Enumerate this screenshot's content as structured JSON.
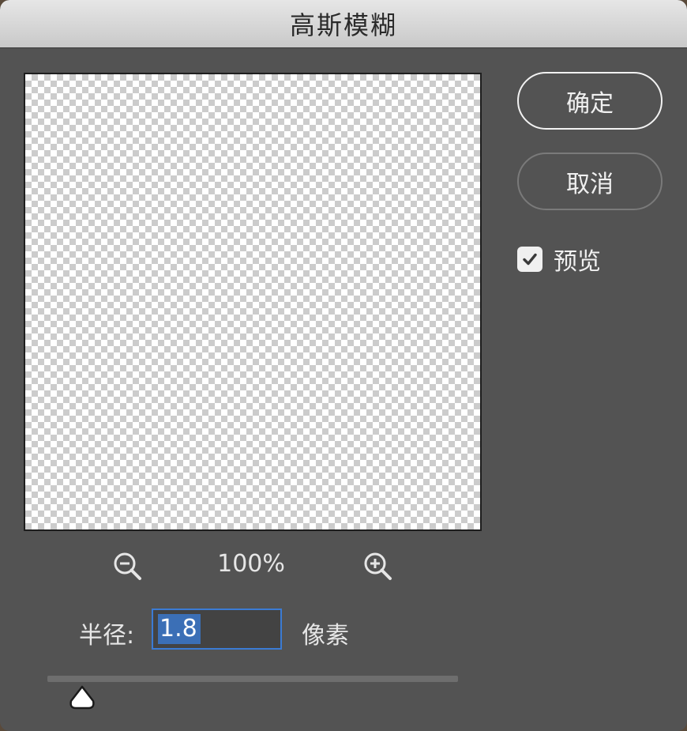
{
  "dialog": {
    "title": "高斯模糊"
  },
  "buttons": {
    "ok_label": "确定",
    "cancel_label": "取消"
  },
  "preview_option": {
    "label": "预览",
    "checked": true
  },
  "zoom": {
    "level": "100%",
    "zoom_out_icon": "zoom-out-icon",
    "zoom_in_icon": "zoom-in-icon"
  },
  "radius": {
    "label": "半径:",
    "value": "1.8",
    "unit": "像素",
    "slider_level": 0.09
  },
  "colors": {
    "dialog_bg": "#535353",
    "input_focus_border": "#3b7bd4",
    "selection_bg": "#3b6fb6"
  }
}
